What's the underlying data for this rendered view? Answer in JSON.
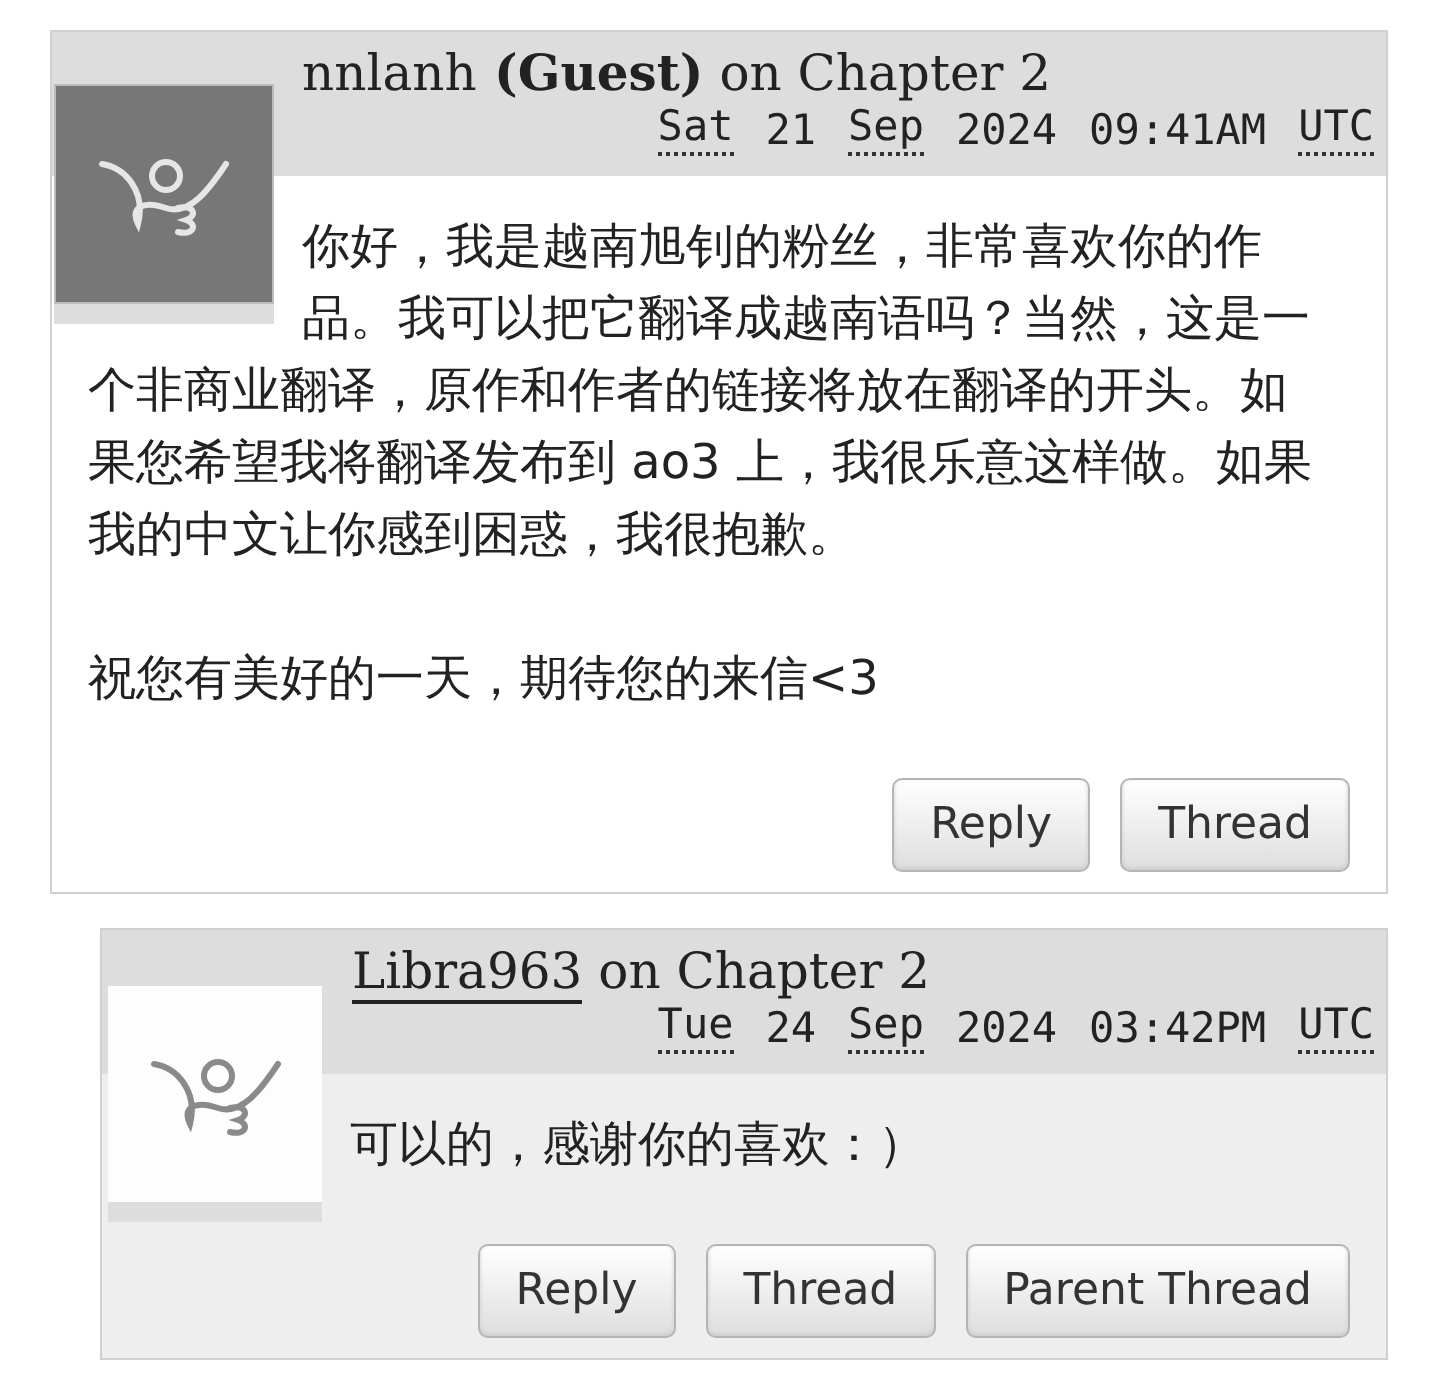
{
  "comments": [
    {
      "nested": false,
      "kind": "guest",
      "author": {
        "name": "nnlanh",
        "suffix": "(Guest)",
        "linked": false
      },
      "on": "on Chapter 2",
      "date": [
        {
          "text": "Sat",
          "abbr": true
        },
        {
          "text": "21",
          "abbr": false
        },
        {
          "text": "Sep",
          "abbr": true
        },
        {
          "text": "2024",
          "abbr": false
        },
        {
          "text": "09:41AM",
          "abbr": false
        },
        {
          "text": "UTC",
          "abbr": true
        }
      ],
      "paragraphs": [
        "你好，我是越南旭钊的粉丝，非常喜欢你的作品。我可以把它翻译成越南语吗？当然，这是一个非商业翻译，原作和作者的链接将放在翻译的开头。如果您希望我将翻译发布到 ao3 上，我很乐意这样做。如果我的中文让你感到困惑，我很抱歉。",
        "祝您有美好的一天，期待您的来信<3"
      ],
      "buttons": [
        "Reply",
        "Thread"
      ]
    },
    {
      "nested": true,
      "kind": "default",
      "author": {
        "name": "Libra963",
        "linked": true
      },
      "on": "on Chapter 2",
      "date": [
        {
          "text": "Tue",
          "abbr": true
        },
        {
          "text": "24",
          "abbr": false
        },
        {
          "text": "Sep",
          "abbr": true
        },
        {
          "text": "2024",
          "abbr": false
        },
        {
          "text": "03:42PM",
          "abbr": false
        },
        {
          "text": "UTC",
          "abbr": true
        }
      ],
      "paragraphs": [
        "可以的，感谢你的喜欢：）"
      ],
      "buttons": [
        "Reply",
        "Thread",
        "Parent Thread"
      ]
    }
  ]
}
